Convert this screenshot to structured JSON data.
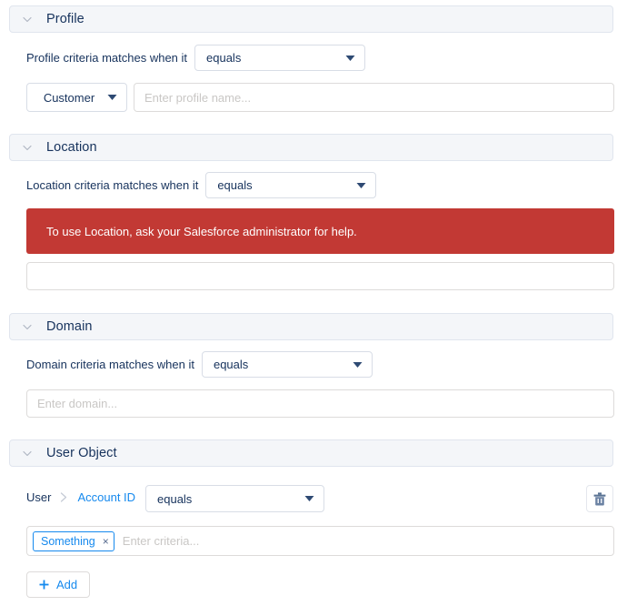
{
  "colors": {
    "accent_blue": "#1589ee",
    "text_navy": "#16325c",
    "error_red": "#c23934",
    "header_bg": "#f4f6f9",
    "border_gray": "#dddbda",
    "placeholder_gray": "#c9c7c5"
  },
  "sections": {
    "profile": {
      "title": "Profile",
      "chevron_icon": "chevron-down-icon",
      "criteria_label": "Profile criteria matches when it",
      "operator": "equals",
      "type_select": "Customer",
      "name_placeholder": "Enter profile name...",
      "name_value": ""
    },
    "location": {
      "title": "Location",
      "chevron_icon": "chevron-down-icon",
      "criteria_label": "Location criteria matches when it",
      "operator": "equals",
      "error_message": "To use Location, ask your Salesforce administrator for help.",
      "input_value": "",
      "input_placeholder": ""
    },
    "domain": {
      "title": "Domain",
      "chevron_icon": "chevron-down-icon",
      "criteria_label": "Domain criteria matches when it",
      "operator": "equals",
      "domain_placeholder": "Enter domain...",
      "domain_value": ""
    },
    "user_object": {
      "title": "User Object",
      "chevron_icon": "chevron-down-icon",
      "breadcrumb_root": "User",
      "breadcrumb_separator_icon": "chevron-right-icon",
      "breadcrumb_field": "Account ID",
      "operator": "equals",
      "delete_icon": "trash-icon",
      "chip_label": "Something",
      "chip_remove_glyph": "×",
      "criteria_placeholder": "Enter criteria...",
      "criteria_value": "",
      "add_label": "Add",
      "add_icon": "plus-icon"
    }
  }
}
